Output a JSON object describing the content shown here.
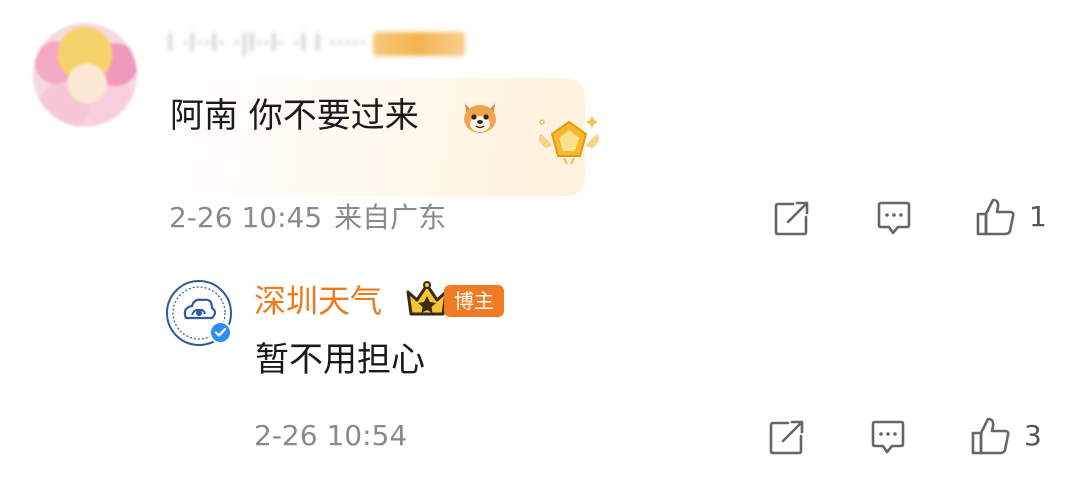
{
  "comment": {
    "username": "l ·l··l· ·|l··l· ·l l  ·····",
    "text": "阿南 你不要过来",
    "emoji": "dog-face-emoji",
    "time": "2-26 10:45",
    "location": "来自广东",
    "like_count": "1"
  },
  "reply": {
    "username": "深圳天气",
    "host_badge": "博主",
    "text": "暂不用担心",
    "time": "2-26 10:54",
    "like_count": "3"
  },
  "icons": [
    "share-icon",
    "comment-icon",
    "like-icon",
    "crown-icon",
    "verified-icon"
  ],
  "colors": {
    "host_name": "#f07a1a",
    "host_badge": "#f37a25",
    "meta_text": "#8a8a8a",
    "verified": "#2f8ff0"
  }
}
